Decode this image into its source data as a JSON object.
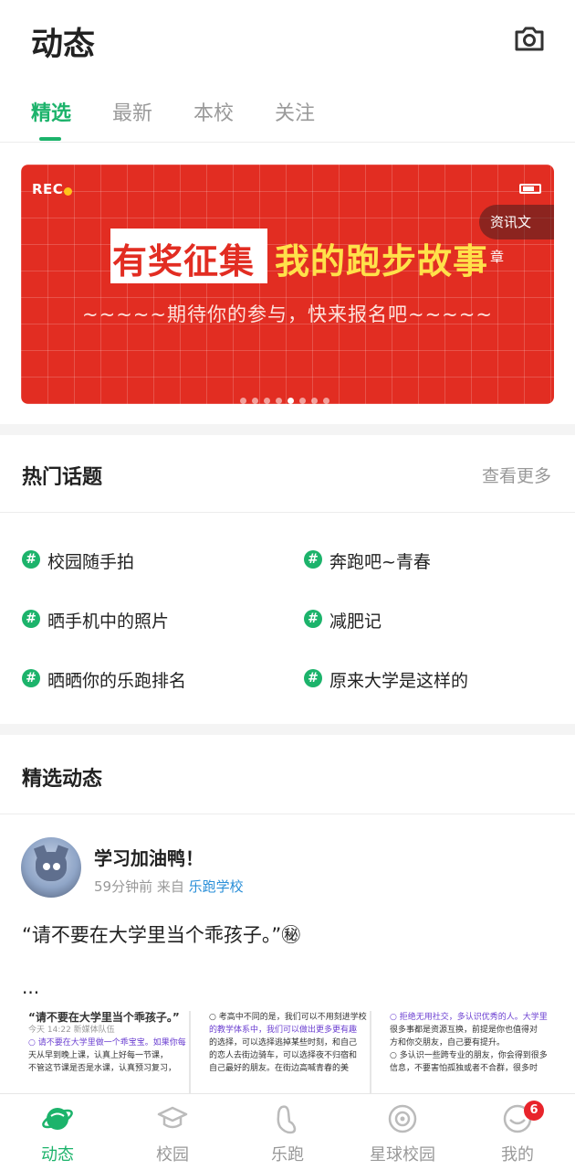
{
  "header": {
    "title": "动态",
    "camera_icon": "camera-icon"
  },
  "tabs": [
    {
      "label": "精选",
      "active": true
    },
    {
      "label": "最新",
      "active": false
    },
    {
      "label": "本校",
      "active": false
    },
    {
      "label": "关注",
      "active": false
    }
  ],
  "banner": {
    "rec_label": "REC",
    "tag": "资讯文章",
    "headline_highlight": "有奖征集",
    "headline_rest": "我的跑步故事",
    "subtitle": "~~~~~期待你的参与，快来报名吧~~~~~",
    "page_count": 8,
    "active_page": 4,
    "colors": {
      "background": "#e22d22",
      "headline_rest": "#ffe14a"
    }
  },
  "hot_topics": {
    "title": "热门话题",
    "more_label": "查看更多",
    "items": [
      {
        "label": "校园随手拍"
      },
      {
        "label": "奔跑吧~青春"
      },
      {
        "label": "晒手机中的照片"
      },
      {
        "label": "减肥记"
      },
      {
        "label": "晒晒你的乐跑排名"
      },
      {
        "label": "原来大学是这样的"
      }
    ]
  },
  "featured": {
    "title": "精选动态",
    "post": {
      "author": "学习加油鸭！",
      "time": "59分钟前",
      "source_prefix": "来自",
      "source": "乐跑学校",
      "text": "“请不要在大学里当个乖孩子。”㊙",
      "ellipsis": "...",
      "thumbs": [
        {
          "lines": [
            "“请不要在大学里当个乖孩子。”",
            "今天 14:22  新媒体队伍",
            "○ 请不要在大学里做一个乖宝宝。如果你每",
            "天从早到晚上课，认真上好每一节课，",
            "不管这节课是否是水课，认真预习复习，"
          ]
        },
        {
          "lines": [
            "○ 考高中不同的是，我们可以不用刻进学校",
            "的教学体系中，我们可以做出更多更有趣",
            "的选择，可以选择逃掉某些时刻，和自己",
            "的恋人去街边骑车，可以选择夜不归宿和",
            "自己最好的朋友。在街边高喊青春的美"
          ]
        },
        {
          "lines": [
            "○ 拒绝无用社交，多认识优秀的人。大学里",
            "很多事都是资源互换，前提是你也值得对",
            "方和你交朋友，自己要有提升。",
            "○ 多认识一些跨专业的朋友，你会得到很多",
            "信息，不要害怕孤独或者不合群，很多时"
          ]
        }
      ]
    }
  },
  "bottom_nav": [
    {
      "label": "动态",
      "icon": "planet-icon",
      "active": true
    },
    {
      "label": "校园",
      "icon": "graduation-cap-icon",
      "active": false
    },
    {
      "label": "乐跑",
      "icon": "footprint-icon",
      "active": false
    },
    {
      "label": "星球校园",
      "icon": "planet-ring-icon",
      "active": false
    },
    {
      "label": "我的",
      "icon": "profile-icon",
      "active": false,
      "badge": "6"
    }
  ],
  "colors": {
    "accent": "#1cb36b",
    "badge": "#e8242b",
    "link": "#2a8fd8"
  }
}
